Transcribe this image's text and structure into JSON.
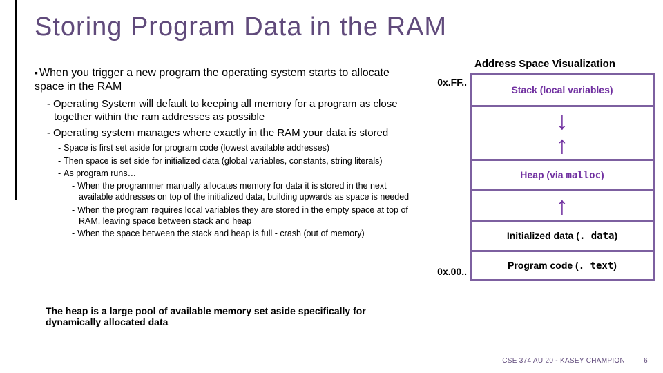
{
  "title": "Storing Program Data in the RAM",
  "lvl1": "When you trigger a new program the operating system starts to allocate space in the RAM",
  "lvl2": [
    "Operating System will default to keeping all memory for a program as close together within the ram addresses as possible",
    "Operating system manages where exactly in the RAM your data is stored"
  ],
  "lvl3": [
    "Space is first set aside for program code (lowest available addresses)",
    "Then space is set side for initialized data (global variables, constants, string literals)",
    "As program runs…"
  ],
  "lvl4": [
    "When the programmer manually allocates memory for data it is stored in the next available addresses on top of the initialized data, building upwards as space is needed",
    "When the program requires local variables they are stored in the empty space at top of RAM, leaving space between stack and heap",
    "When the space between the stack and heap is full - crash (out of memory)"
  ],
  "summary": "The heap is a large pool of available memory set aside specifically for dynamically allocated data",
  "diagram": {
    "title": "Address Space Visualization",
    "top_addr": "0x.FF..",
    "bot_addr": "0x.00..",
    "stack": "Stack (local variables)",
    "heap_prefix": "Heap (via ",
    "heap_mono": "malloc",
    "heap_suffix": ")",
    "data_prefix": "Initialized data (",
    "data_mono": ". data",
    "data_suffix": ")",
    "code_prefix": "Program code (",
    "code_mono": ". text",
    "code_suffix": ")"
  },
  "footer": {
    "course": "CSE 374 AU 20 - KASEY CHAMPION",
    "page": "6"
  }
}
